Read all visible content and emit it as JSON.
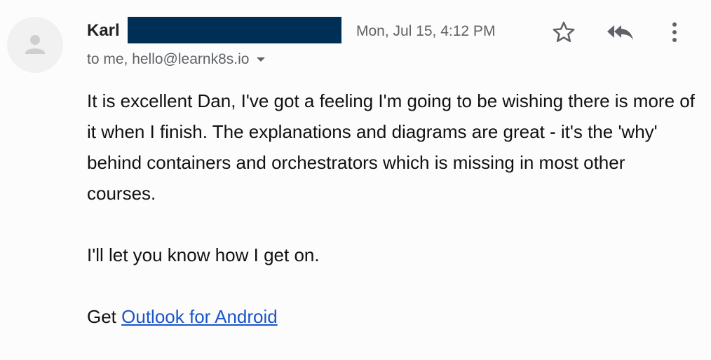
{
  "header": {
    "sender_name": "Karl",
    "date": "Mon, Jul 15, 4:12 PM",
    "recipients": "to me, hello@learnk8s.io"
  },
  "icons": {
    "avatar": "person-icon",
    "star": "star-icon",
    "reply": "reply-all-icon",
    "more": "more-vert-icon",
    "caret": "caret-down-icon"
  },
  "colors": {
    "redaction": "#002f55",
    "link": "#1a55c8",
    "muted_text": "#5f6368"
  },
  "body": {
    "paragraph_1": "It is excellent Dan, I've got a feeling I'm going to be wishing there is more of it when I finish. The explanations and diagrams are great - it's the 'why' behind containers and orchestrators which is missing in most other courses.",
    "paragraph_2": "I'll let you know how I get on.",
    "signature_prefix": "Get ",
    "signature_link": "Outlook for Android"
  }
}
